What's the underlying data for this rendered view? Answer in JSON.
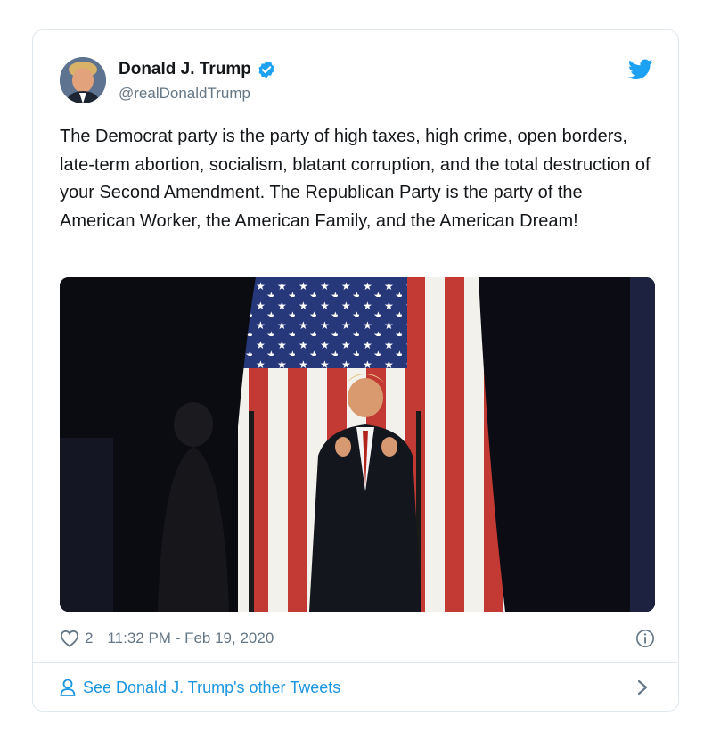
{
  "tweet": {
    "display_name": "Donald J. Trump",
    "handle": "@realDonaldTrump",
    "text": "The Democrat party is the party of high taxes, high crime, open borders, late-term abortion, socialism, blatant corruption, and the total destruction of your Second Amendment. The Republican Party is the party of the American Worker, the American Family, and the American Dream!",
    "likes": "2",
    "timestamp": "11:32 PM - Feb 19, 2020",
    "more_link": "See Donald J. Trump's other Tweets"
  },
  "icons": {
    "verified": "verified-badge-icon",
    "brand": "twitter-bird-icon",
    "like": "heart-icon",
    "info": "info-icon",
    "profile": "person-icon",
    "chevron": "chevron-right-icon"
  },
  "colors": {
    "accent": "#1da1f2",
    "link": "#1b95e0",
    "text": "#14171a",
    "muted": "#657786",
    "border": "#e1e8ed"
  }
}
